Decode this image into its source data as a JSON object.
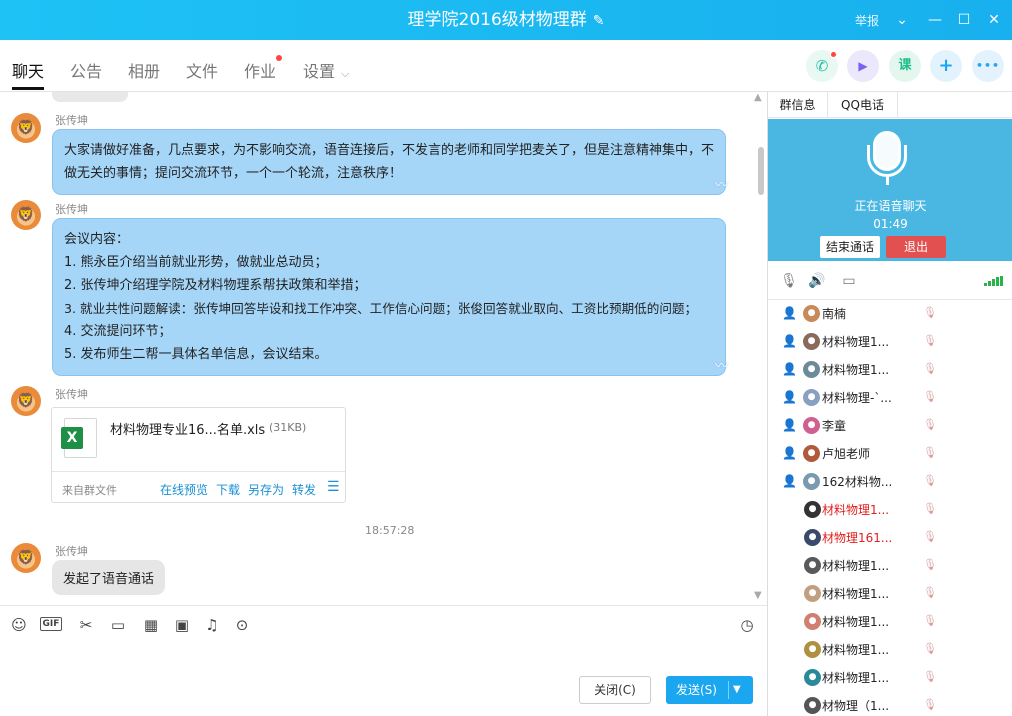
{
  "window": {
    "title": "理学院2016级材物理群",
    "report": "举报",
    "edit_icon": "pencil-icon"
  },
  "tabs": [
    {
      "label": "聊天",
      "active": true
    },
    {
      "label": "公告"
    },
    {
      "label": "相册"
    },
    {
      "label": "文件"
    },
    {
      "label": "作业",
      "dot": true
    },
    {
      "label": "设置"
    }
  ],
  "toolbar_icons": [
    {
      "name": "phone-call-icon",
      "color": "#1fc0a0",
      "glyph": "✆",
      "dot": true
    },
    {
      "name": "video-call-icon",
      "color": "#7b61f0",
      "glyph": "▶"
    },
    {
      "name": "lesson-icon",
      "color": "#1bbd8a",
      "glyph": "课"
    },
    {
      "name": "add-app-icon",
      "color": "#1aa7f0",
      "glyph": "+"
    },
    {
      "name": "more-icon",
      "color": "#2aa6f0",
      "glyph": "•••"
    }
  ],
  "chat": {
    "sender": "张传坤",
    "msg1": "大家请做好准备，几点要求，为不影响交流，语音连接后，不发言的老师和同学把麦关了，但是注意精神集中，不做无关的事情；提问交流环节，一个一个轮流，注意秩序！",
    "msg2_lines": [
      "会议内容：",
      "1. 熊永臣介绍当前就业形势，做就业总动员；",
      "2. 张传坤介绍理学院及材料物理系帮扶政策和举措；",
      "3. 就业共性问题解读：张传坤回答毕设和找工作冲突、工作信心问题；张俊回答就业取向、工资比预期低的问题；",
      "4. 交流提问环节；",
      "5. 发布师生二帮一具体名单信息，会议结束。"
    ],
    "file": {
      "name": "材料物理专业16...名单.xls",
      "size": "(31KB)",
      "source": "来自群文件",
      "actions": [
        "在线预览",
        "下载",
        "另存为",
        "转发"
      ]
    },
    "timestamp": "18:57:28",
    "msg3": "发起了语音通话"
  },
  "input": {
    "close_label": "关闭(C)",
    "send_label": "发送(S)"
  },
  "panel": {
    "tabs": [
      "群信息",
      "QQ电话"
    ],
    "voice_status": "正在语音聊天",
    "voice_time": "01:49",
    "end_call": "结束通话",
    "exit": "退出"
  },
  "members": [
    {
      "name": "南楠",
      "role": true,
      "color": "#c98a58"
    },
    {
      "name": "材料物理1...",
      "role": true,
      "color": "#8a6a5a"
    },
    {
      "name": "材料物理1...",
      "role": true,
      "color": "#6b8a9a"
    },
    {
      "name": "材料物理-`...",
      "role": true,
      "color": "#8aa0c0"
    },
    {
      "name": "李童",
      "role": true,
      "color": "#d06090"
    },
    {
      "name": "卢旭老师",
      "role": true,
      "color": "#b05a3a"
    },
    {
      "name": "162材料物...",
      "role": true,
      "color": "#7a9ab0"
    },
    {
      "name": "材料物理1...",
      "red": true,
      "color": "#333333"
    },
    {
      "name": "材物理161...",
      "red": true,
      "color": "#3a4a6a"
    },
    {
      "name": "材料物理1...",
      "color": "#5a5a5a"
    },
    {
      "name": "材料物理1...",
      "color": "#c0a080"
    },
    {
      "name": "材料物理1...",
      "color": "#d08070"
    },
    {
      "name": "材料物理1...",
      "color": "#b09040"
    },
    {
      "name": "材料物理1...",
      "color": "#2a8a9a"
    },
    {
      "name": "材物理（1...",
      "color": "#555555"
    }
  ]
}
